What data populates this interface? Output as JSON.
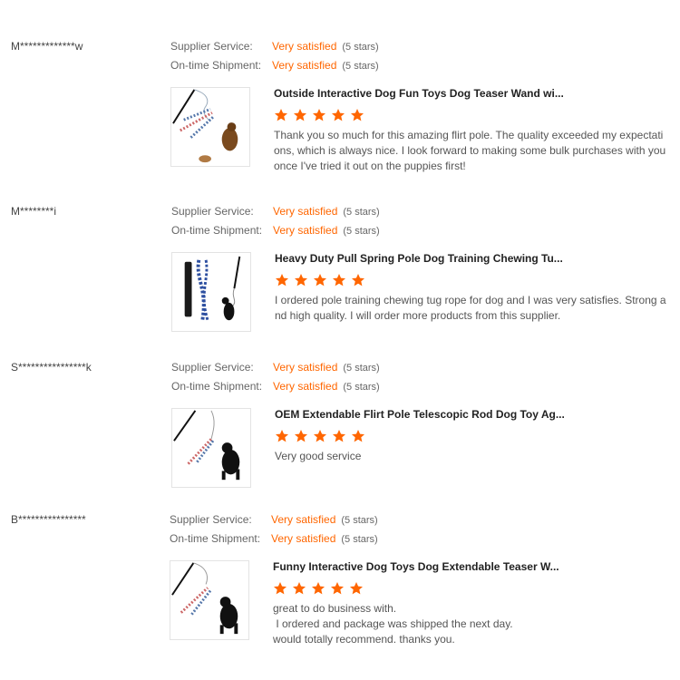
{
  "colors": {
    "accent": "#ff6600",
    "star": "#ff6600",
    "text": "#555555"
  },
  "reviews": [
    {
      "reviewer": "M*************w",
      "supplier_label": "Supplier Service:",
      "supplier_value": "Very satisfied",
      "supplier_stars": "(5 stars)",
      "shipment_label": "On-time Shipment:",
      "shipment_value": "Very satisfied",
      "shipment_stars": "(5 stars)",
      "product_title": "Outside Interactive Dog Fun Toys Dog Teaser Wand wi...",
      "rating": 5,
      "text": "Thank you so much for this amazing flirt pole. The quality exceeded my expectati\nons, which is always nice. I look forward to making some bulk purchases with you\nonce I've tried it out on the puppies first!"
    },
    {
      "reviewer": "M********i",
      "supplier_label": "Supplier Service:",
      "supplier_value": "Very satisfied",
      "supplier_stars": "(5 stars)",
      "shipment_label": "On-time Shipment:",
      "shipment_value": "Very satisfied",
      "shipment_stars": "(5 stars)",
      "product_title": "Heavy Duty Pull Spring Pole Dog Training Chewing Tu...",
      "rating": 5,
      "text": "I ordered pole training chewing tug rope for dog and I was very satisfies. Strong a\nnd high quality. I will order more products from this supplier."
    },
    {
      "reviewer": "S****************k",
      "supplier_label": "Supplier Service:",
      "supplier_value": "Very satisfied",
      "supplier_stars": "(5 stars)",
      "shipment_label": "On-time Shipment:",
      "shipment_value": "Very satisfied",
      "shipment_stars": "(5 stars)",
      "product_title": "OEM Extendable Flirt Pole Telescopic Rod Dog Toy Ag...",
      "rating": 5,
      "text": "Very good service"
    },
    {
      "reviewer": "B****************",
      "supplier_label": "Supplier Service:",
      "supplier_value": "Very satisfied",
      "supplier_stars": "(5 stars)",
      "shipment_label": "On-time Shipment:",
      "shipment_value": "Very satisfied",
      "shipment_stars": "(5 stars)",
      "product_title": "Funny Interactive Dog Toys Dog Extendable Teaser W...",
      "rating": 5,
      "text": "great to do business with.\n I ordered and package was shipped the next day.\nwould totally recommend. thanks you."
    }
  ]
}
